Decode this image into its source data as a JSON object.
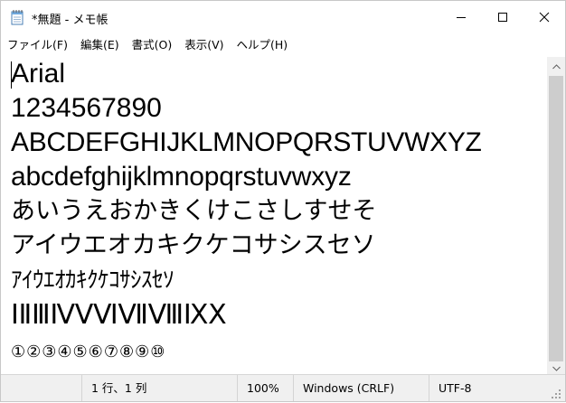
{
  "window": {
    "title": "*無題 - メモ帳",
    "app_icon": "notepad-icon"
  },
  "caption_buttons": {
    "minimize": "minimize-icon",
    "maximize": "maximize-icon",
    "close": "close-icon"
  },
  "menu": {
    "items": [
      {
        "label": "ファイル(F)",
        "accel": "F"
      },
      {
        "label": "編集(E)",
        "accel": "E"
      },
      {
        "label": "書式(O)",
        "accel": "O"
      },
      {
        "label": "表示(V)",
        "accel": "V"
      },
      {
        "label": "ヘルプ(H)",
        "accel": "H"
      }
    ]
  },
  "editor": {
    "lines": [
      "Arial",
      "1234567890",
      "ABCDEFGHIJKLMNOPQRSTUVWXYZ",
      "abcdefghijklmnopqrstuvwxyz",
      "あいうえおかきくけこさしすせそ",
      "アイウエオカキクケコサシスセソ",
      "ｱｲｳｴｵｶｷｸｹｺｻｼｽｾｿ",
      "ⅠⅡⅢⅣⅤⅥⅦⅧⅨⅩ",
      "①②③④⑤⑥⑦⑧⑨⑩"
    ]
  },
  "statusbar": {
    "position": "1 行、1 列",
    "zoom": "100%",
    "line_ending": "Windows (CRLF)",
    "encoding": "UTF-8"
  },
  "colors": {
    "scroll_thumb": "#cdcdcd",
    "statusbar_bg": "#f0f0f0"
  }
}
